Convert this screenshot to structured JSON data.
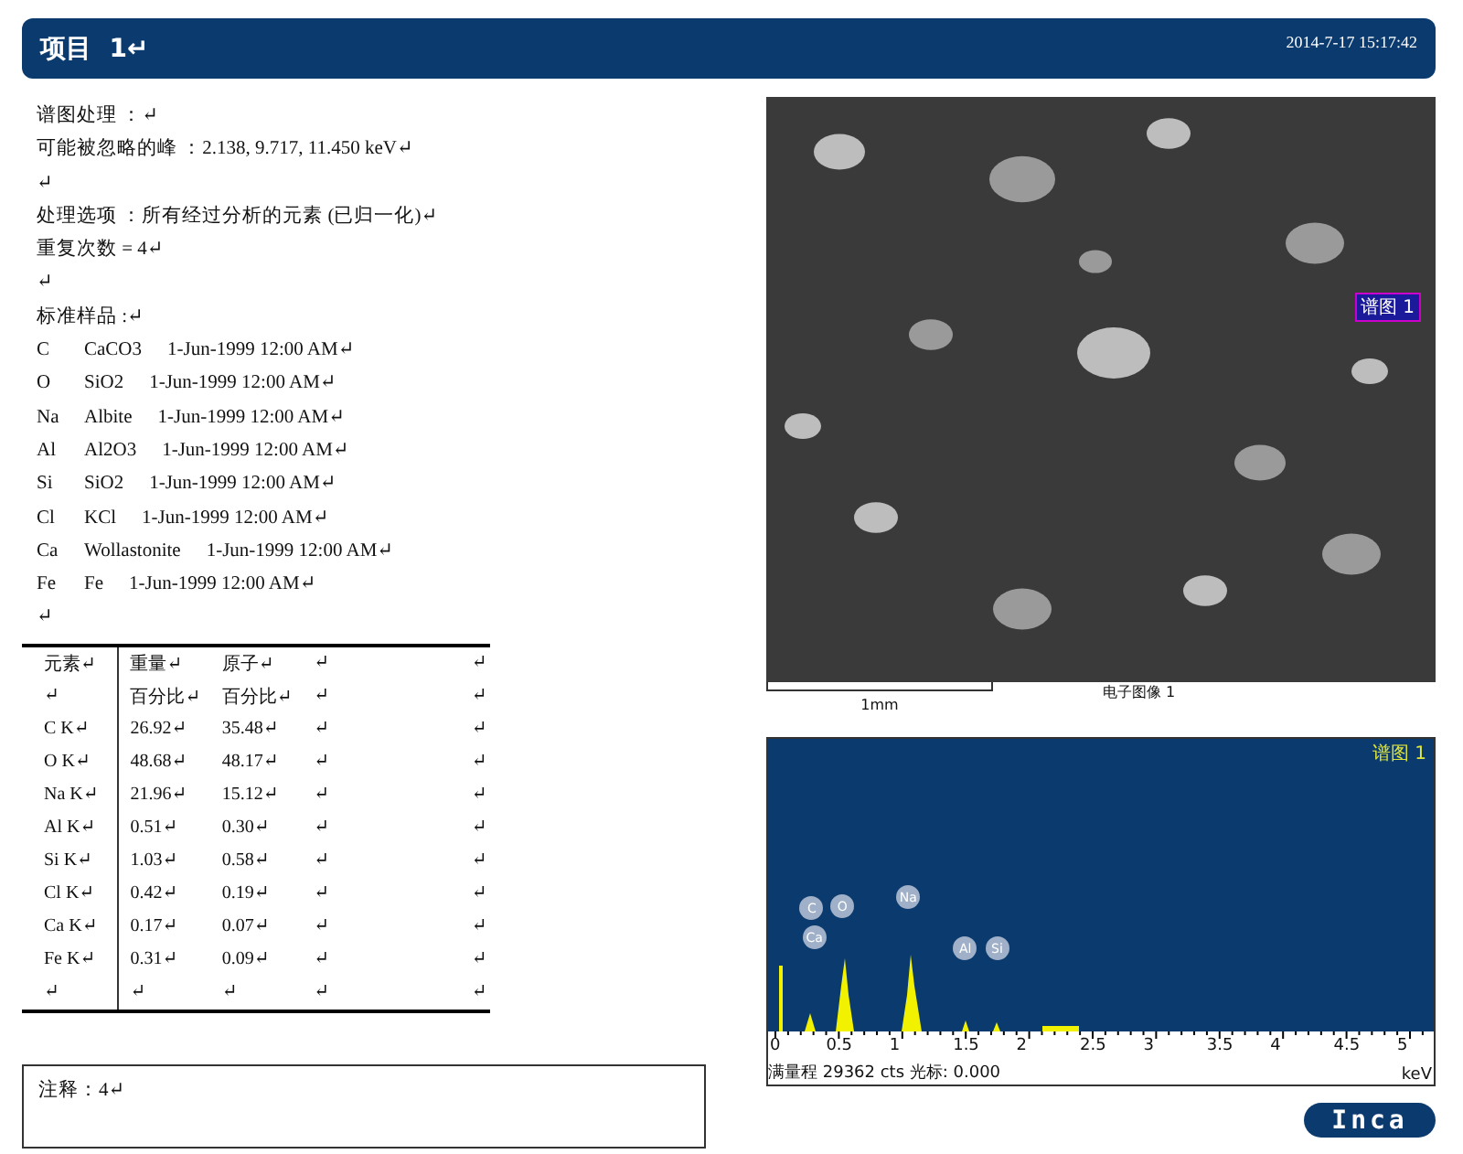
{
  "header": {
    "title": "项目  1↵",
    "timestamp": "2014-7-17 15:17:42"
  },
  "info_lines": [
    "谱图处理 ：↵",
    "可能被忽略的峰 ：2.138, 9.717, 11.450 keV↵",
    "↵",
    "处理选项 ：所有经过分析的元素 (已归一化)↵",
    "重复次数 = 4↵",
    "↵",
    "标准样品 :↵"
  ],
  "standards": [
    {
      "element": "C",
      "standard": "CaCO3",
      "date": "1-Jun-1999 12:00 AM↵"
    },
    {
      "element": "O",
      "standard": "SiO2",
      "date": "1-Jun-1999 12:00 AM↵"
    },
    {
      "element": "Na",
      "standard": "Albite",
      "date": "1-Jun-1999 12:00 AM↵"
    },
    {
      "element": "Al",
      "standard": "Al2O3",
      "date": "1-Jun-1999 12:00 AM↵"
    },
    {
      "element": "Si",
      "standard": "SiO2",
      "date": "1-Jun-1999 12:00 AM↵"
    },
    {
      "element": "Cl",
      "standard": "KCl",
      "date": "1-Jun-1999 12:00 AM↵"
    },
    {
      "element": "Ca",
      "standard": "Wollastonite",
      "date": "1-Jun-1999 12:00 AM↵"
    },
    {
      "element": "Fe",
      "standard": "Fe",
      "date": "1-Jun-1999 12:00 AM↵"
    }
  ],
  "after_standards": "↵",
  "table": {
    "rows": [
      [
        "元素↵",
        "重量↵",
        "原子↵",
        "↵",
        "↵"
      ],
      [
        "↵",
        "百分比↵",
        "百分比↵",
        "↵",
        "↵"
      ],
      [
        "C K↵",
        "26.92↵",
        "35.48↵",
        "↵",
        "↵"
      ],
      [
        "O K↵",
        "48.68↵",
        "48.17↵",
        "↵",
        "↵"
      ],
      [
        "Na K↵",
        "21.96↵",
        "15.12↵",
        "↵",
        "↵"
      ],
      [
        "Al K↵",
        "0.51↵",
        "0.30↵",
        "↵",
        "↵"
      ],
      [
        "Si K↵",
        "1.03↵",
        "0.58↵",
        "↵",
        "↵"
      ],
      [
        "Cl K↵",
        "0.42↵",
        "0.19↵",
        "↵",
        "↵"
      ],
      [
        "Ca K↵",
        "0.17↵",
        "0.07↵",
        "↵",
        "↵"
      ],
      [
        "Fe K↵",
        "0.31↵",
        "0.09↵",
        "↵",
        "↵"
      ],
      [
        "↵",
        "↵",
        "↵",
        "↵",
        "↵"
      ]
    ]
  },
  "note": "注释：4↵",
  "sem_image": {
    "kind": "picture",
    "marker_label": "谱图 1",
    "scale_label": "1mm",
    "caption": "电子图像 1"
  },
  "spectrum": {
    "title": "谱图 1",
    "peak_labels": [
      "C",
      "Ca",
      "O",
      "Na",
      "Al",
      "Si"
    ],
    "x_tick_labels": [
      "0",
      "0.5",
      "1",
      "1.5",
      "2",
      "2.5",
      "3",
      "3.5",
      "4",
      "4.5",
      "5"
    ],
    "footer": "满量程 29362 cts 光标: 0.000",
    "unit": "keV"
  },
  "logo": "Inca"
}
